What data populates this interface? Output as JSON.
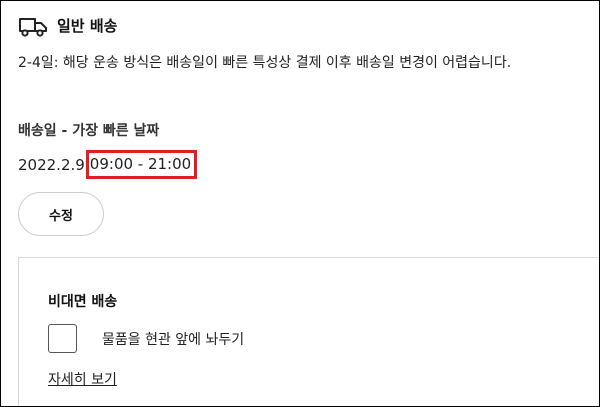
{
  "shipping": {
    "icon": "truck-icon",
    "title": "일반 배송",
    "notice": "2-4일: 해당 운송 방식은 배송일이 빠른 특성상 결제 이후 배송일 변경이 어렵습니다."
  },
  "delivery_date": {
    "heading": "배송일 - 가장 빠른 날짜",
    "date": "2022.2.9",
    "time_range": "09:00 - 21:00",
    "highlight_color": "#e02020"
  },
  "edit_button": {
    "label": "수정"
  },
  "contactless": {
    "title": "비대면 배송",
    "checkbox_label": "물품을 현관 앞에 놔두기",
    "checkbox_checked": false,
    "details_link": "자세히 보기"
  }
}
